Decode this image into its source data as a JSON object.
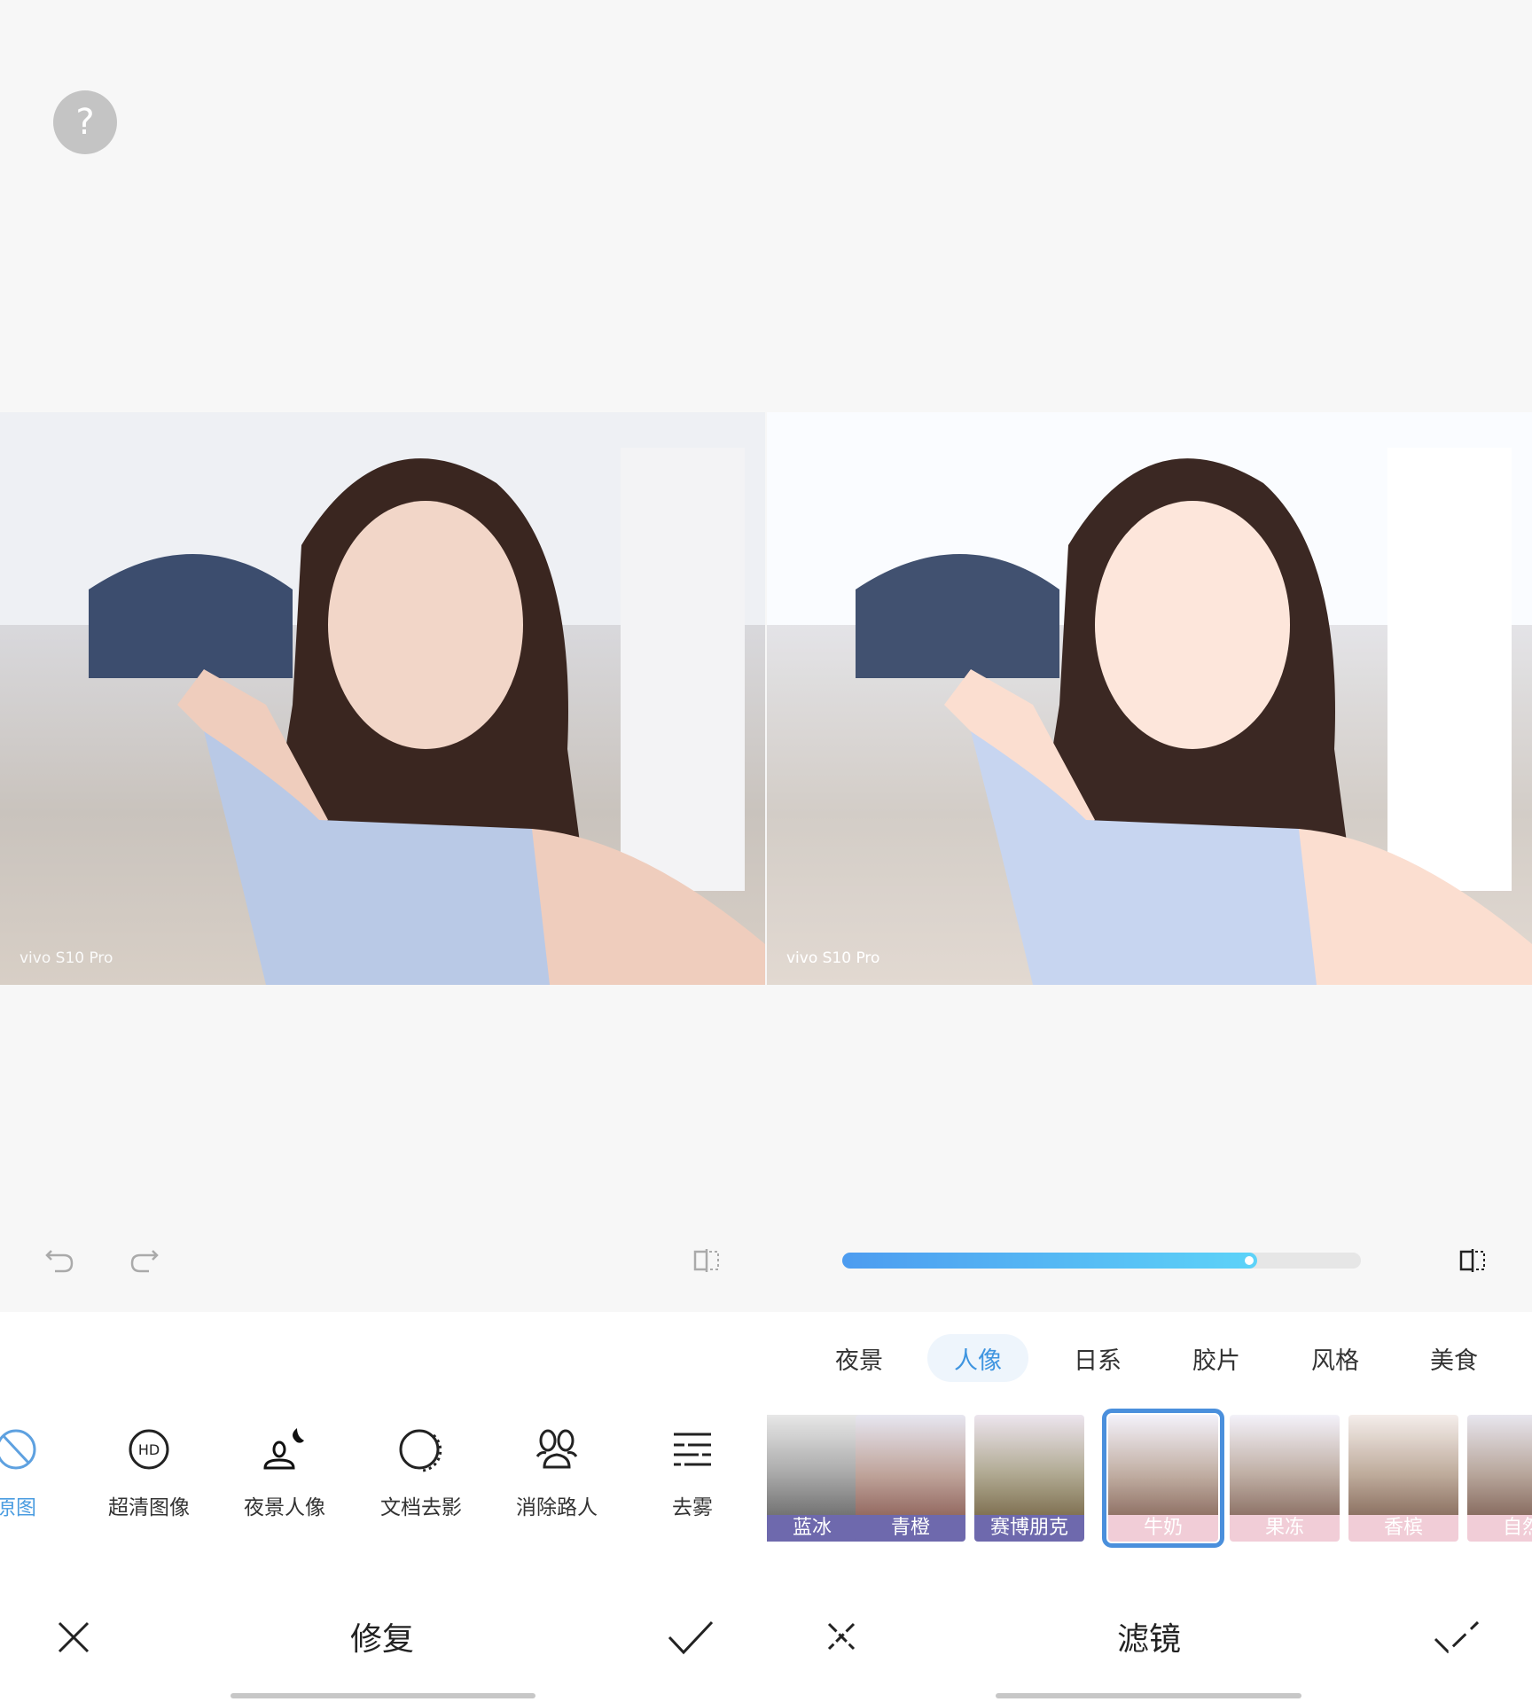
{
  "help": {
    "icon": "question-icon",
    "label": "?"
  },
  "photos": {
    "left": {
      "watermark": "vivo S10 Pro"
    },
    "right": {
      "watermark": "vivo S10 Pro"
    }
  },
  "left_toolbar": {
    "undo_icon": "undo-icon",
    "redo_icon": "redo-icon",
    "compare_icon": "compare-icon"
  },
  "right_toolbar": {
    "intensity_percent": 80,
    "accent_gradient": [
      "#4d9cf0",
      "#5dd3f8"
    ],
    "compare_icon": "compare-icon"
  },
  "repair_tools": [
    {
      "label": "原图",
      "icon": "original-icon",
      "active": true
    },
    {
      "label": "超清图像",
      "icon": "hd-icon"
    },
    {
      "label": "夜景人像",
      "icon": "night-portrait-icon"
    },
    {
      "label": "文档去影",
      "icon": "document-shadow-icon"
    },
    {
      "label": "消除路人",
      "icon": "remove-people-icon"
    },
    {
      "label": "去雾",
      "icon": "dehaze-icon"
    }
  ],
  "filter_tabs": [
    {
      "label": "夜景"
    },
    {
      "label": "人像",
      "active": true
    },
    {
      "label": "日系"
    },
    {
      "label": "胶片"
    },
    {
      "label": "风格"
    },
    {
      "label": "美食"
    }
  ],
  "filters": [
    {
      "label": "蓝冰",
      "band_color": "#6e69ad"
    },
    {
      "label": "青橙",
      "band_color": "#6e69ad"
    },
    {
      "label": "赛博朋克",
      "band_color": "#6e69ad"
    },
    {
      "label": "牛奶",
      "band_color": "#f1cdd7",
      "selected": true
    },
    {
      "label": "果冻",
      "band_color": "#f1cdd7"
    },
    {
      "label": "香槟",
      "band_color": "#f1cdd7"
    },
    {
      "label": "自然",
      "band_color": "#f1cdd7"
    }
  ],
  "left_footer": {
    "title": "修复",
    "cancel_icon": "close-icon",
    "confirm_icon": "check-icon"
  },
  "right_footer": {
    "title": "滤镜",
    "cancel_icon": "close-icon",
    "confirm_icon": "check-icon"
  },
  "colors": {
    "accent": "#3f95e0",
    "selected_border": "#4a8fdc"
  }
}
